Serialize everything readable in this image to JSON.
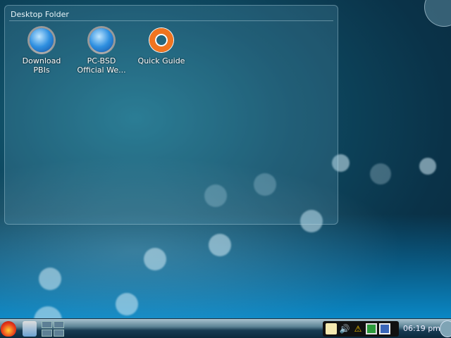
{
  "folder": {
    "title": "Desktop Folder",
    "icons": [
      {
        "label_1": "Download",
        "label_2": "PBIs",
        "icon": "globe-gear-icon"
      },
      {
        "label_1": "PC-BSD",
        "label_2": "Official We...",
        "icon": "globe-gear-icon"
      },
      {
        "label_1": "Quick Guide",
        "label_2": "",
        "icon": "lifebuoy-icon"
      }
    ]
  },
  "taskbar": {
    "clock": "06:19 pm",
    "tray": [
      "clipboard-icon",
      "volume-icon",
      "warning-icon",
      "network-icon",
      "update-icon"
    ]
  }
}
